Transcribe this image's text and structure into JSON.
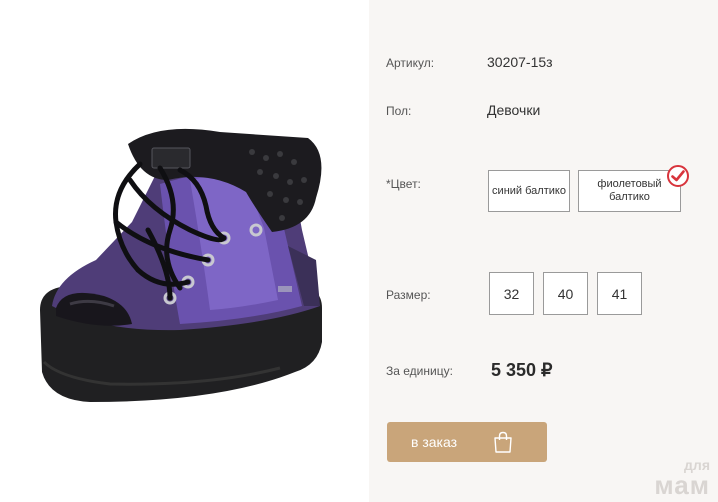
{
  "product": {
    "image_alt": "purple winter boot",
    "article_label": "Артикул:",
    "article_value": "30207-15з",
    "gender_label": "Пол:",
    "gender_value": "Девочки",
    "color_label": "*Цвет:",
    "colors": [
      {
        "label": "синий балтико",
        "selected": false
      },
      {
        "label": "фиолетовый балтико",
        "selected": true
      }
    ],
    "size_label": "Размер:",
    "sizes": [
      "32",
      "40",
      "41"
    ],
    "price_label": "За единицу:",
    "price_value": "5 350 ₽",
    "order_button_label": "в заказ"
  },
  "watermark": {
    "line1": "для",
    "line2": "мам"
  },
  "colors": {
    "accent_gold": "#c9a57a",
    "check_red": "#d8343c",
    "panel_bg": "#f8f6f4",
    "border": "#9a9a9a"
  },
  "icons": {
    "selected_check": "check-circle-icon",
    "order_button": "shopping-bag-icon"
  }
}
